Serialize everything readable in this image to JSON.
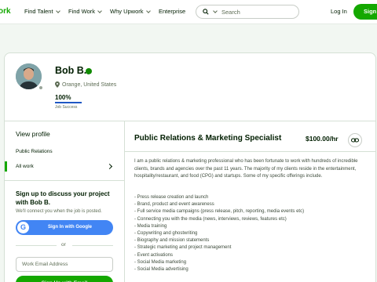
{
  "nav": {
    "logo": "ork",
    "items": [
      "Find Talent",
      "Find Work",
      "Why Upwork",
      "Enterprise"
    ],
    "search_placeholder": "Search",
    "login": "Log In",
    "signup": "Sign"
  },
  "profile": {
    "name": "Bob B.",
    "location": "Orange, United States",
    "job_success_value": "100%",
    "job_success_fraction": 1.0,
    "job_success_label": "Job Success"
  },
  "sidebar": {
    "view_profile": "View profile",
    "items": [
      "Public Relations",
      "All work"
    ]
  },
  "signup_panel": {
    "title": "Sign up to discuss your project with Bob B.",
    "subtitle": "We'll connect you when the job is posted.",
    "google_label": "Sign In with Google",
    "or_text": "or",
    "email_placeholder": "Work Email Address",
    "email_button": "Sign Up with Email"
  },
  "specialized_profile": {
    "title": "Public Relations & Marketing Specialist",
    "rate": "$100.00/hr",
    "description": "I am a public relations & marketing professional who has been fortunate to work with hundreds of incredible clients, brands and agencies over the past 11 years. The majority of my clients reside in the entertainment, hospitality/restaurant, and food (CPG) and startups. Some of my specific offerings include.",
    "offerings": [
      "- Press release creation and launch",
      "- Brand, product and event awareness",
      "- Full service media campaigns (press release, pitch, reporting, media events etc)",
      "- Connecting you with the media (news, interviews, reviews, features etc)",
      "- Media training",
      "- Copywriting and ghostwriting",
      "- Biography and mission statements",
      "- Strategic marketing and project management",
      "- Event activations",
      "- Social Media marketing",
      "- Social Media advertising"
    ]
  },
  "colors": {
    "brand_green": "#14a800",
    "google_blue": "#4285f4",
    "job_success_blue": "#1f57c3"
  }
}
